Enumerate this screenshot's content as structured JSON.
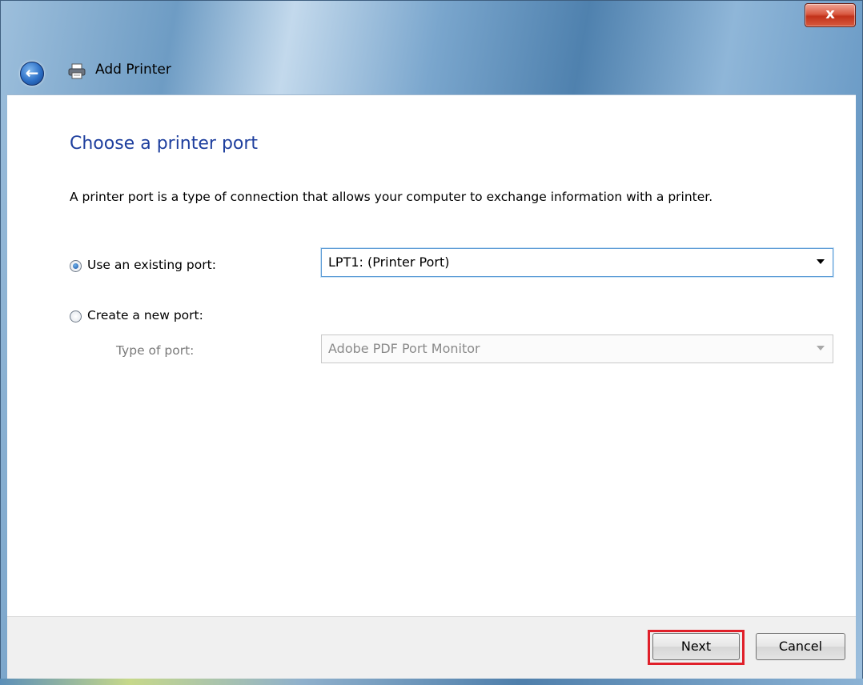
{
  "window": {
    "title": "Add Printer",
    "close_glyph": "x"
  },
  "page": {
    "heading": "Choose a printer port",
    "description": "A printer port is a type of connection that allows your computer to exchange information with a printer."
  },
  "options": {
    "existing": {
      "label": "Use an existing port:",
      "selected": true,
      "value": "LPT1: (Printer Port)"
    },
    "new": {
      "label": "Create a new port:",
      "selected": false,
      "type_label": "Type of port:",
      "type_value": "Adobe PDF Port Monitor"
    }
  },
  "buttons": {
    "next": "Next",
    "cancel": "Cancel"
  },
  "icons": {
    "back": "back-arrow-icon",
    "printer": "printer-icon",
    "close": "close-icon"
  },
  "colors": {
    "heading": "#1e3f9e",
    "highlight": "#e0202a",
    "close_button": "#c2321a"
  }
}
